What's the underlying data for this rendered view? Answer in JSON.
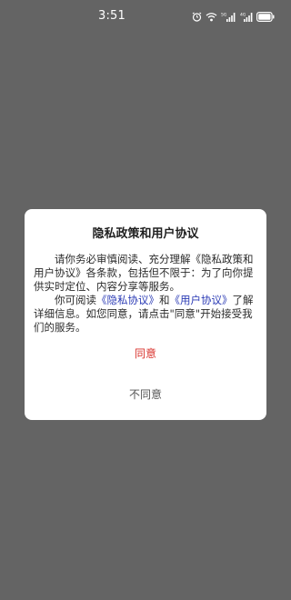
{
  "status_bar": {
    "time": "3:51",
    "icons": [
      "alarm-icon",
      "wifi-icon",
      "signal-5g-icon",
      "signal-4g-icon",
      "battery-icon"
    ]
  },
  "dialog": {
    "title": "隐私政策和用户协议",
    "paragraph1": "请你务必审慎阅读、充分理解《隐私政策和用户协议》各条款，包括但不限于：为了向你提供实时定位、内容分享等服务。",
    "paragraph2_prefix": "你可阅读",
    "privacy_link": "《隐私协议》",
    "paragraph2_and": "和",
    "user_agreement_link": "《用户协议》",
    "paragraph2_suffix": "了解详细信息。如您同意，请点击\"同意\"开始接受我们的服务。",
    "agree_label": "同意",
    "disagree_label": "不同意"
  },
  "colors": {
    "overlay": "#646464",
    "link": "#2b3bb5",
    "agree": "#d8322c",
    "disagree": "#555555"
  }
}
